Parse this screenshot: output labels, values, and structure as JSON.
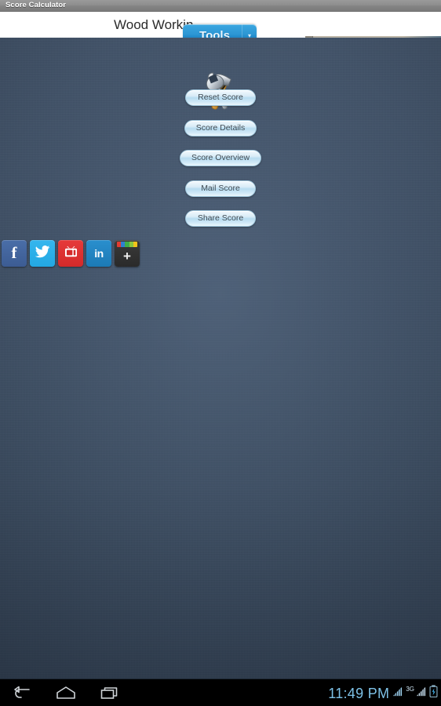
{
  "window": {
    "title": "Score Calculator"
  },
  "browser": {
    "page_title": "Wood Workin",
    "tab": {
      "label": "Tools",
      "caret_icon": "chevron-down-icon"
    },
    "top_image_alt": "banner-image"
  },
  "app": {
    "header_icon": "hammer-wrench-tools-icon",
    "buttons": [
      {
        "label": "Reset Score",
        "name": "reset-score-button"
      },
      {
        "label": "Score Details",
        "name": "score-details-button"
      },
      {
        "label": "Score Overview",
        "name": "score-overview-button"
      },
      {
        "label": "Mail Score",
        "name": "mail-score-button"
      },
      {
        "label": "Share Score",
        "name": "share-score-button"
      }
    ],
    "social": [
      {
        "name": "facebook-share-button",
        "icon": "facebook-icon",
        "glyph": "f",
        "color": "#3c5c93"
      },
      {
        "name": "twitter-share-button",
        "icon": "twitter-icon",
        "glyph": "",
        "color": "#23a8e3"
      },
      {
        "name": "youtube-share-button",
        "icon": "youtube-tv-icon",
        "glyph": "",
        "color": "#d42a2a"
      },
      {
        "name": "linkedin-share-button",
        "icon": "linkedin-icon",
        "glyph": "in",
        "color": "#1c7ab5"
      },
      {
        "name": "more-share-button",
        "icon": "addthis-plus-icon",
        "glyph": "+",
        "color": "#2a2a2a"
      }
    ]
  },
  "navbar": {
    "back_icon": "back-arrow-icon",
    "home_icon": "home-icon",
    "recents_icon": "recent-apps-icon",
    "clock": "11:49 PM",
    "network_label": "3G",
    "signal_icon": "signal-bars-icon",
    "battery_icon": "battery-charging-icon",
    "clock_color": "#7ec2e8"
  },
  "colors": {
    "accent_blue": "#2c96d4",
    "app_background": "#3c4c61",
    "pill_face": "#d9ecf7"
  }
}
